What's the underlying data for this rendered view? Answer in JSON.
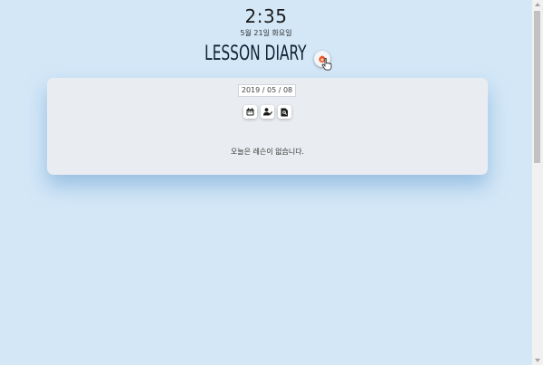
{
  "header": {
    "clock": "2:35",
    "date": "5월 21일 화요일",
    "title": "LESSON DIARY"
  },
  "card": {
    "date_value": "2019 / 05 / 08",
    "empty_message": "오늘은 레슨이 없습니다."
  },
  "icons": {
    "fab": "fire-icon",
    "calendar": "calendar-icon",
    "student": "user-check-icon",
    "search": "search-document-icon"
  },
  "colors": {
    "background": "#d3e7f7",
    "card": "#e9ecf0",
    "title": "#0f2236",
    "fab_accent": "#e8542a"
  }
}
